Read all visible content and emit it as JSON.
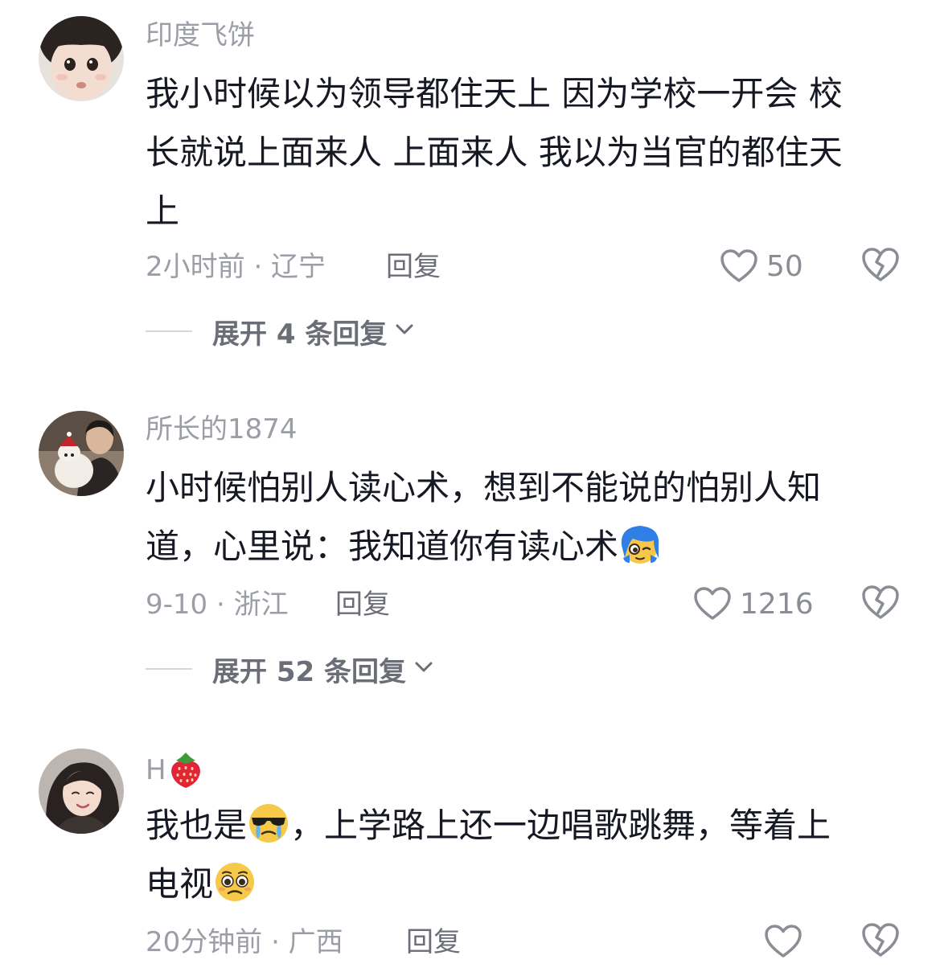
{
  "comments": [
    {
      "username": "印度飞饼",
      "text_lines": [
        "我小时候以为领导都住天上 因为学校一开会 校",
        "长就说上面来人 上面来人 我以为当官的都住天",
        "上"
      ],
      "meta": "2小时前 · 辽宁",
      "reply_label": "回复",
      "likes": "50",
      "expand_label": "展开 4 条回复"
    },
    {
      "username": "所长的1874",
      "text_lines": [
        "小时候怕别人读心术，想到不能说的怕别人知",
        "道，心里说：我知道你有读心术"
      ],
      "meta": "9-10 · 浙江",
      "reply_label": "回复",
      "likes": "1216",
      "expand_label": "展开 52 条回复"
    },
    {
      "username": "H",
      "username_emoji": "strawberry-icon",
      "text_line1_a": "我也是",
      "text_line1_b": "，上学路上还一边唱歌跳舞，等着上",
      "text_line2": "电视",
      "meta": "20分钟前 · 广西",
      "reply_label": "回复",
      "likes": ""
    }
  ],
  "icons": {
    "like": "heart-outline-icon",
    "dislike": "broken-heart-icon",
    "expand": "chevron-down-icon",
    "emoji_c2": "blue-hair-wink-emoji-icon",
    "emoji_c3_a": "sunglasses-crying-emoji-icon",
    "emoji_c3_b": "pleading-emoji-icon"
  },
  "colors": {
    "text": "#161823",
    "secondary": "#9b9ea6",
    "action": "#6b6e76",
    "background": "#ffffff"
  }
}
